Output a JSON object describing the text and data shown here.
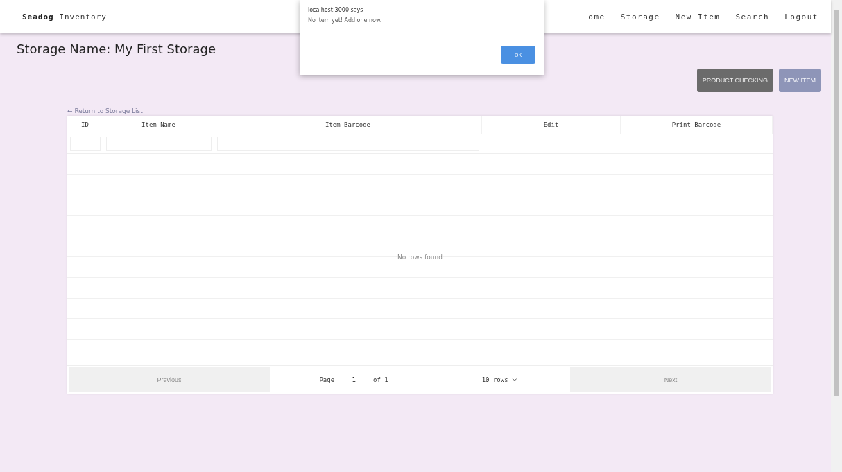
{
  "navbar": {
    "brand_bold": "Seadog",
    "brand_rest": "Inventory",
    "links": [
      "ome",
      "Storage",
      "New Item",
      "Search",
      "Logout"
    ]
  },
  "dialog": {
    "title": "localhost:3000 says",
    "message": "No item yet! Add one now.",
    "button": "OK"
  },
  "heading": "Storage Name: My First Storage",
  "actions": [
    {
      "label": "PRODUCT CHECKING",
      "disabled": false
    },
    {
      "label": "NEW ITEM",
      "disabled": true
    }
  ],
  "back_link": "← Return to Storage List",
  "table": {
    "columns": [
      {
        "label": "ID",
        "kind": "filterable"
      },
      {
        "label": "Item Name",
        "kind": "filterable"
      },
      {
        "label": "Item Barcode",
        "kind": "filterable"
      },
      {
        "label": "Edit",
        "kind": "plain"
      },
      {
        "label": "Print Barcode",
        "kind": "plain"
      }
    ],
    "empty_text": "No rows found"
  },
  "pagination": {
    "previous": {
      "label": "Previous",
      "disabled": true
    },
    "page_label": "Page",
    "page_value": "1",
    "of_label": "of 1",
    "rows_select": "10 rows",
    "next": {
      "label": "Next",
      "disabled": true
    }
  }
}
